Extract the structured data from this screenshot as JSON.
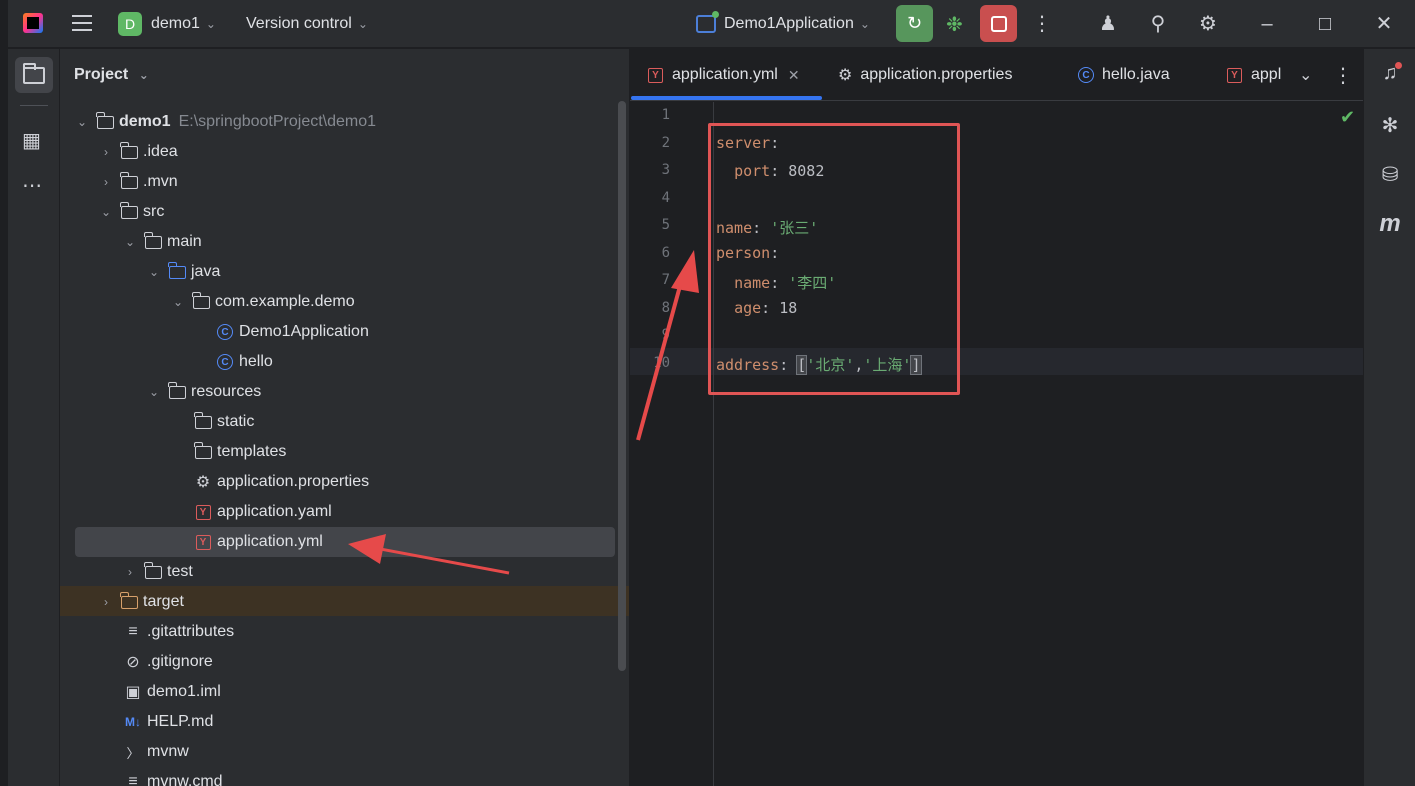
{
  "titlebar": {
    "project_badge": "D",
    "project_name": "demo1",
    "vcs_label": "Version control",
    "run_config": "Demo1Application"
  },
  "project_panel": {
    "title": "Project",
    "root": {
      "name": "demo1",
      "path": "E:\\springbootProject\\demo1"
    },
    "rows": [
      ".idea",
      ".mvn",
      "src",
      "main",
      "java",
      "com.example.demo",
      "Demo1Application",
      "hello",
      "resources",
      "static",
      "templates",
      "application.properties",
      "application.yaml",
      "application.yml",
      "test",
      "target",
      ".gitattributes",
      ".gitignore",
      "demo1.iml",
      "HELP.md",
      "mvnw",
      "mvnw.cmd"
    ]
  },
  "tabs": [
    {
      "label": "application.yml",
      "active": true,
      "icon": "yaml-icon"
    },
    {
      "label": "application.properties",
      "icon": "gear-icon"
    },
    {
      "label": "hello.java",
      "icon": "class-icon"
    },
    {
      "label": "appl",
      "icon": "yaml-icon"
    }
  ],
  "editor": {
    "line_numbers": [
      "1",
      "2",
      "3",
      "4",
      "5",
      "6",
      "7",
      "8",
      "9",
      "10"
    ],
    "code": {
      "l2_key": "server",
      "l3_key": "port",
      "l3_val": "8082",
      "l5_key": "name",
      "l5_val": "'张三'",
      "l6_key": "person",
      "l7_key": "name",
      "l7_val": "'李四'",
      "l8_key": "age",
      "l8_val": "18",
      "l10_key": "address",
      "l10_v1": "'北京'",
      "l10_v2": "'上海'"
    }
  },
  "colors": {
    "accent": "#3574f0",
    "annotation_red": "#e05555",
    "run_green": "#57965c",
    "stop_red": "#c94f4f"
  }
}
